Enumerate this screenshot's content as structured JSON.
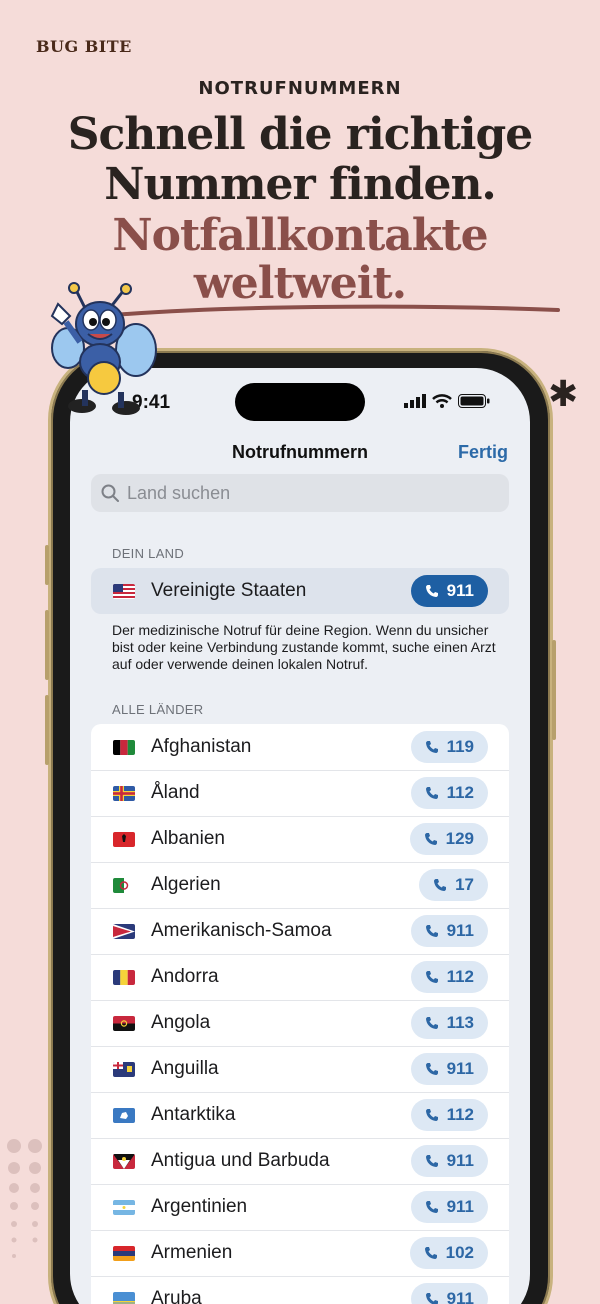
{
  "brand": "BUG BITE",
  "eyebrow": "NOTRUFNUMMERN",
  "headline": [
    "Schnell die richtige",
    "Nummer finden."
  ],
  "subline": [
    "Notfallkontakte",
    "weltweit."
  ],
  "status": {
    "time": "9:41"
  },
  "nav": {
    "title": "Notrufnummern",
    "done": "Fertig"
  },
  "search": {
    "placeholder": "Land suchen"
  },
  "my_country": {
    "header": "DEIN LAND",
    "name": "Vereinigte Staaten",
    "number": "911",
    "note": "Der medizinische Notruf für deine Region. Wenn du unsicher bist oder keine Verbindung zustande kommt, suche einen Arzt auf oder verwende deinen lokalen Notruf."
  },
  "all_header": "ALLE LÄNDER",
  "countries": [
    {
      "name": "Afghanistan",
      "number": "119"
    },
    {
      "name": "Åland",
      "number": "112"
    },
    {
      "name": "Albanien",
      "number": "129"
    },
    {
      "name": "Algerien",
      "number": "17"
    },
    {
      "name": "Amerikanisch-Samoa",
      "number": "911"
    },
    {
      "name": "Andorra",
      "number": "112"
    },
    {
      "name": "Angola",
      "number": "113"
    },
    {
      "name": "Anguilla",
      "number": "911"
    },
    {
      "name": "Antarktika",
      "number": "112"
    },
    {
      "name": "Antigua und Barbuda",
      "number": "911"
    },
    {
      "name": "Argentinien",
      "number": "911"
    },
    {
      "name": "Armenien",
      "number": "102"
    },
    {
      "name": "Aruba",
      "number": "911"
    }
  ],
  "colors": {
    "accent": "#1e5fa3",
    "pill": "#dde8f4",
    "headline": "#2a2320",
    "subline": "#8a4f4a",
    "background": "#f5dcd9"
  }
}
